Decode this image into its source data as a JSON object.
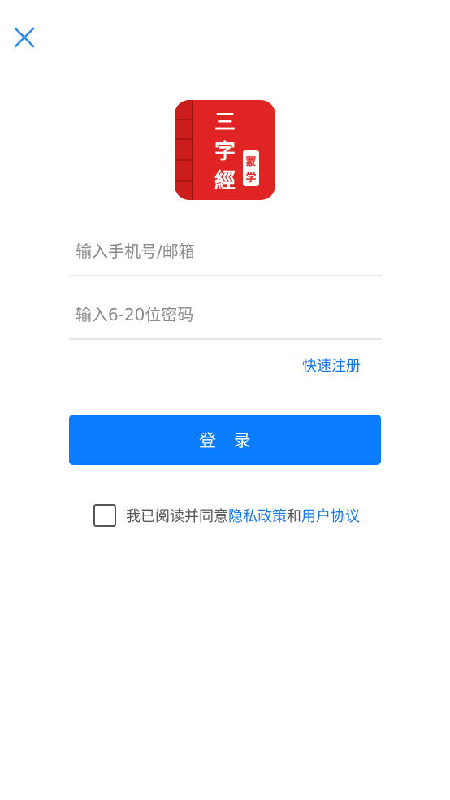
{
  "header": {
    "close_icon": "close-icon"
  },
  "logo": {
    "icon": "book-icon",
    "title_chars": [
      "三",
      "字",
      "經"
    ],
    "tag_chars": [
      "蒙",
      "学"
    ]
  },
  "form": {
    "phone_placeholder": "输入手机号/邮箱",
    "password_placeholder": "输入6-20位密码",
    "register_label": "快速注册",
    "login_label": "登   录"
  },
  "agreement": {
    "prefix": "我已阅读并同意",
    "privacy_label": "隐私政策",
    "connector": "和",
    "terms_label": "用户协议"
  },
  "colors": {
    "accent": "#0a7cff",
    "link": "#1677e6",
    "logo_red": "#e02424"
  }
}
